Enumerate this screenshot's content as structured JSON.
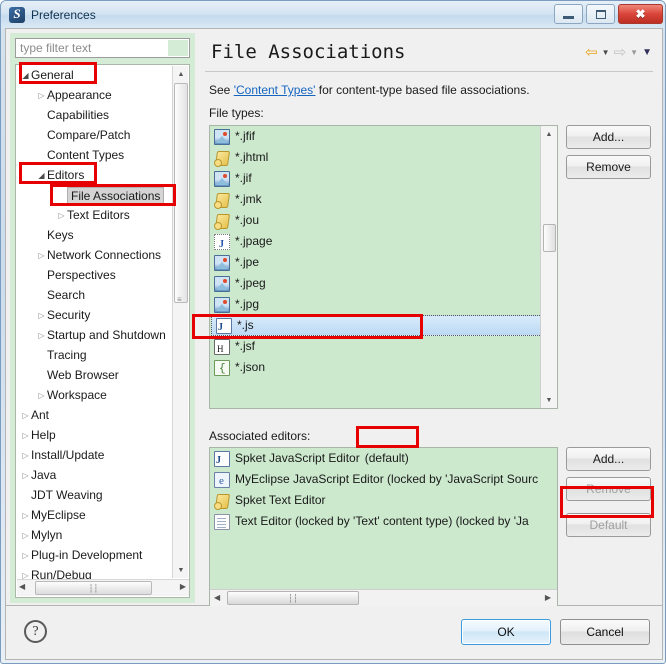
{
  "window": {
    "title": "Preferences",
    "icon": "spket-app-icon",
    "buttons": {
      "minimize": "minimize-icon",
      "maximize": "maximize-icon",
      "close": "close-icon"
    }
  },
  "sidebar": {
    "filter": {
      "placeholder": "type filter text",
      "value": ""
    },
    "items": [
      {
        "label": "General",
        "indent": 0,
        "arrow": "open"
      },
      {
        "label": "Appearance",
        "indent": 1,
        "arrow": "closed"
      },
      {
        "label": "Capabilities",
        "indent": 1,
        "arrow": "none"
      },
      {
        "label": "Compare/Patch",
        "indent": 1,
        "arrow": "none"
      },
      {
        "label": "Content Types",
        "indent": 1,
        "arrow": "none"
      },
      {
        "label": "Editors",
        "indent": 1,
        "arrow": "open"
      },
      {
        "label": "File Associations",
        "indent": 2,
        "arrow": "none",
        "selected": true
      },
      {
        "label": "Text Editors",
        "indent": 2,
        "arrow": "closed"
      },
      {
        "label": "Keys",
        "indent": 1,
        "arrow": "none"
      },
      {
        "label": "Network Connections",
        "indent": 1,
        "arrow": "closed"
      },
      {
        "label": "Perspectives",
        "indent": 1,
        "arrow": "none"
      },
      {
        "label": "Search",
        "indent": 1,
        "arrow": "none"
      },
      {
        "label": "Security",
        "indent": 1,
        "arrow": "closed"
      },
      {
        "label": "Startup and Shutdown",
        "indent": 1,
        "arrow": "closed"
      },
      {
        "label": "Tracing",
        "indent": 1,
        "arrow": "none"
      },
      {
        "label": "Web Browser",
        "indent": 1,
        "arrow": "none"
      },
      {
        "label": "Workspace",
        "indent": 1,
        "arrow": "closed"
      },
      {
        "label": "Ant",
        "indent": 0,
        "arrow": "closed"
      },
      {
        "label": "Help",
        "indent": 0,
        "arrow": "closed"
      },
      {
        "label": "Install/Update",
        "indent": 0,
        "arrow": "closed"
      },
      {
        "label": "Java",
        "indent": 0,
        "arrow": "closed"
      },
      {
        "label": "JDT Weaving",
        "indent": 0,
        "arrow": "none"
      },
      {
        "label": "MyEclipse",
        "indent": 0,
        "arrow": "closed"
      },
      {
        "label": "Mylyn",
        "indent": 0,
        "arrow": "closed"
      },
      {
        "label": "Plug-in Development",
        "indent": 0,
        "arrow": "closed"
      },
      {
        "label": "Run/Debug",
        "indent": 0,
        "arrow": "closed"
      }
    ]
  },
  "page": {
    "title": "File Associations",
    "description_pre": "See ",
    "description_link": "'Content Types'",
    "description_post": " for content-type based file associations.",
    "file_types_label": "File types:",
    "associated_editors_label": "Associated editors:"
  },
  "nav": {
    "back": "back-arrow-icon",
    "back_menu": "chevron-down-icon",
    "forward": "forward-arrow-icon",
    "forward_menu": "chevron-down-icon",
    "menu": "chevron-down-icon"
  },
  "file_types": [
    {
      "name": "*.jfif",
      "icon": "image-file-icon"
    },
    {
      "name": "*.jhtml",
      "icon": "scroll-file-icon"
    },
    {
      "name": "*.jif",
      "icon": "image-file-icon"
    },
    {
      "name": "*.jmk",
      "icon": "scroll-file-icon"
    },
    {
      "name": "*.jou",
      "icon": "scroll-file-icon"
    },
    {
      "name": "*.jpage",
      "icon": "jpage-file-icon"
    },
    {
      "name": "*.jpe",
      "icon": "image-file-icon"
    },
    {
      "name": "*.jpeg",
      "icon": "image-file-icon"
    },
    {
      "name": "*.jpg",
      "icon": "image-file-icon"
    },
    {
      "name": "*.js",
      "icon": "javascript-file-icon",
      "selected": true
    },
    {
      "name": "*.jsf",
      "icon": "html-file-icon"
    },
    {
      "name": "*.json",
      "icon": "json-file-icon"
    }
  ],
  "associated_editors": [
    {
      "name": "Spket JavaScript Editor",
      "suffix": "(default)",
      "icon": "javascript-editor-icon"
    },
    {
      "name": "MyEclipse JavaScript Editor (locked by 'JavaScript Sourc",
      "suffix": "",
      "icon": "myeclipse-editor-icon"
    },
    {
      "name": "Spket Text Editor",
      "suffix": "",
      "icon": "scroll-file-icon"
    },
    {
      "name": "Text Editor (locked by 'Text' content type) (locked by 'Ja",
      "suffix": "",
      "icon": "text-editor-icon"
    }
  ],
  "buttons": {
    "add_file_type": "Add...",
    "remove_file_type": "Remove",
    "add_editor": "Add...",
    "remove_editor": "Remove",
    "default_editor": "Default",
    "help": "?",
    "ok": "OK",
    "cancel": "Cancel"
  },
  "colors": {
    "list_background": "#cce8cd",
    "sidebar_background": "#d4ecd5",
    "selection": "#bcd9f3",
    "annotation": "#e60000",
    "link": "#1565c0",
    "titlebar": "#cbdcec"
  }
}
